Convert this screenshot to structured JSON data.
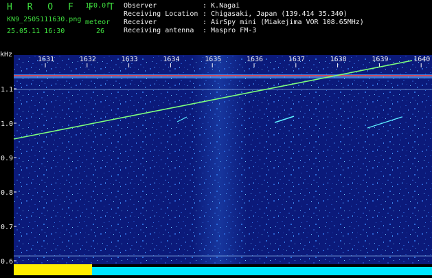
{
  "header": {
    "app_title": "H R O F F T",
    "version": "1.0.0f",
    "filename": "KN9_2505111630.png",
    "datetime": "25.05.11 16:30",
    "meteor_label": "meteor",
    "meteor_count": "26",
    "info": [
      {
        "label": "Observer",
        "value": ": K.Nagai"
      },
      {
        "label": "Receiving Location",
        "value": ": Chigasaki, Japan (139.414 35.340)"
      },
      {
        "label": "Receiver",
        "value": ": AirSpy mini (Miakejima VOR 108.65MHz)"
      },
      {
        "label": "Receiving antenna",
        "value": ": Maspro FM-3"
      }
    ]
  },
  "spectrogram": {
    "y_unit": "kHz",
    "y_ticks": [
      "1.1",
      "1.0",
      "0.9",
      "0.8",
      "0.7",
      "0.6"
    ],
    "x_ticks": [
      "1631",
      "1632",
      "1633",
      "1634",
      "1635",
      "1636",
      "1637",
      "1638",
      "1639",
      "1640"
    ]
  },
  "colors": {
    "header_text": "#3fe03f",
    "info_text": "#f2f2f2",
    "plot_bg": "#0b1a7a",
    "signal_line": "#7dff7d",
    "carrier_band": "#ff3b3b",
    "footer_bar": "#00e5ff",
    "footer_yellow": "#ffee00"
  }
}
